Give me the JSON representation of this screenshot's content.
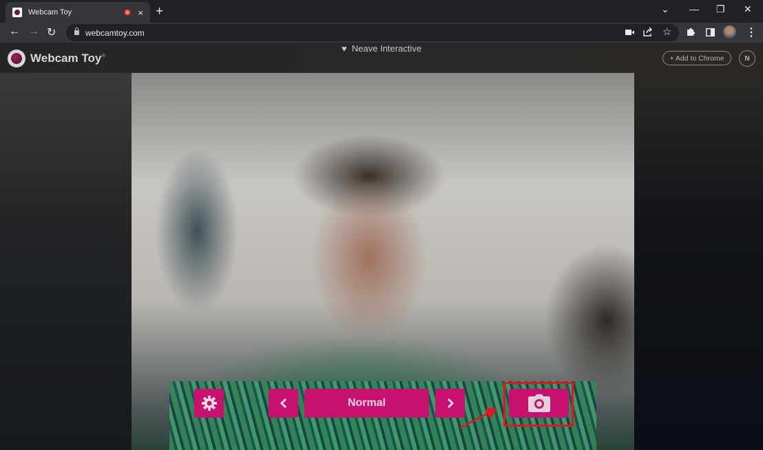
{
  "browser": {
    "tab": {
      "title": "Webcam Toy",
      "recording_indicator": "recording-icon",
      "close": "×"
    },
    "new_tab": "+",
    "window_controls": {
      "tab_search": "⌄",
      "minimize": "—",
      "restore": "❐",
      "close": "✕"
    },
    "nav": {
      "back": "←",
      "forward": "→",
      "reload": "↻"
    },
    "address": {
      "url": "webcamtoy.com"
    },
    "omnibox_icons": [
      "camera-in-use-icon",
      "share-icon",
      "bookmark-star-icon"
    ],
    "toolbar_icons": [
      "extensions-icon",
      "side-panel-icon",
      "profile-avatar",
      "menu-icon"
    ]
  },
  "site": {
    "brand": "Webcam Toy",
    "registered": "®",
    "credit_heart": "♥",
    "credit": "Neave Interactive",
    "add_to_chrome": "+ Add to Chrome",
    "n_button": "N"
  },
  "controls": {
    "settings": "gear-icon",
    "prev": "‹",
    "filter_name": "Normal",
    "next": "›",
    "capture": "camera-icon"
  },
  "annotation": {
    "highlight_color": "#e8141c",
    "target": "capture-button"
  },
  "colors": {
    "accent": "#c8106f"
  }
}
